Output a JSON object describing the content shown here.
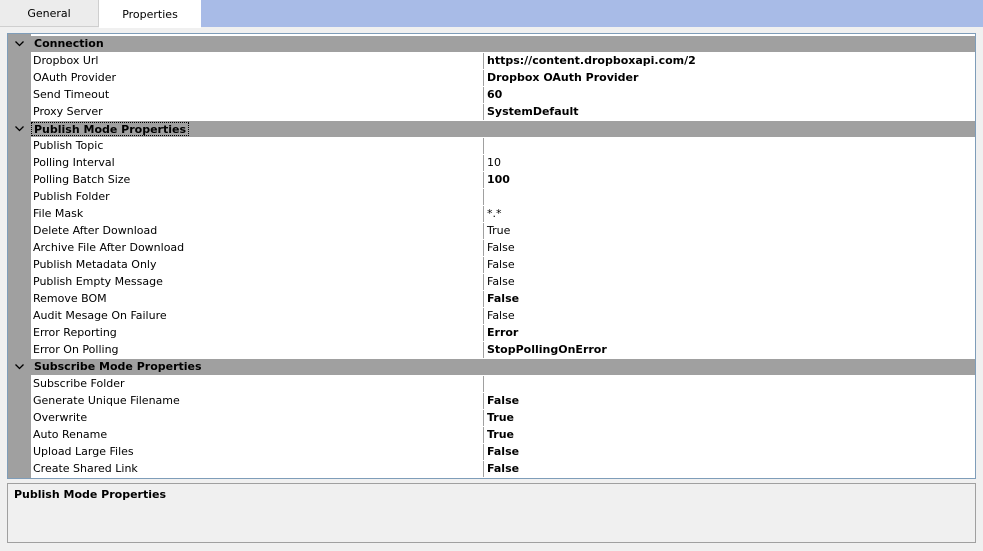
{
  "tabs": [
    {
      "label": "General"
    },
    {
      "label": "Properties"
    }
  ],
  "categories": [
    {
      "label": "Connection",
      "rows": [
        {
          "name": "Dropbox Url",
          "value": "https://content.dropboxapi.com/2",
          "bold": true
        },
        {
          "name": "OAuth Provider",
          "value": "Dropbox OAuth Provider",
          "bold": true
        },
        {
          "name": "Send Timeout",
          "value": "60",
          "bold": true
        },
        {
          "name": "Proxy Server",
          "value": "SystemDefault",
          "bold": true
        }
      ]
    },
    {
      "label": "Publish Mode Properties",
      "rows": [
        {
          "name": "Publish Topic",
          "value": "",
          "bold": false
        },
        {
          "name": "Polling Interval",
          "value": "10",
          "bold": false
        },
        {
          "name": "Polling Batch Size",
          "value": "100",
          "bold": true
        },
        {
          "name": "Publish Folder",
          "value": "",
          "bold": false
        },
        {
          "name": "File Mask",
          "value": "*.*",
          "bold": false
        },
        {
          "name": "Delete After Download",
          "value": "True",
          "bold": false
        },
        {
          "name": "Archive File After Download",
          "value": "False",
          "bold": false
        },
        {
          "name": "Publish Metadata Only",
          "value": "False",
          "bold": false
        },
        {
          "name": "Publish Empty Message",
          "value": "False",
          "bold": false
        },
        {
          "name": "Remove BOM",
          "value": "False",
          "bold": true
        },
        {
          "name": "Audit Mesage On Failure",
          "value": "False",
          "bold": false
        },
        {
          "name": "Error Reporting",
          "value": "Error",
          "bold": true
        },
        {
          "name": "Error On Polling",
          "value": "StopPollingOnError",
          "bold": true
        }
      ]
    },
    {
      "label": "Subscribe Mode Properties",
      "rows": [
        {
          "name": "Subscribe Folder",
          "value": "",
          "bold": false
        },
        {
          "name": "Generate Unique Filename",
          "value": "False",
          "bold": true
        },
        {
          "name": "Overwrite",
          "value": "True",
          "bold": true
        },
        {
          "name": "Auto Rename",
          "value": "True",
          "bold": true
        },
        {
          "name": "Upload Large Files",
          "value": "False",
          "bold": true
        },
        {
          "name": "Create Shared Link",
          "value": "False",
          "bold": true
        }
      ]
    }
  ],
  "description": {
    "title": "Publish Mode Properties"
  },
  "icons": {
    "category_toggle": "chevron-down-icon"
  }
}
